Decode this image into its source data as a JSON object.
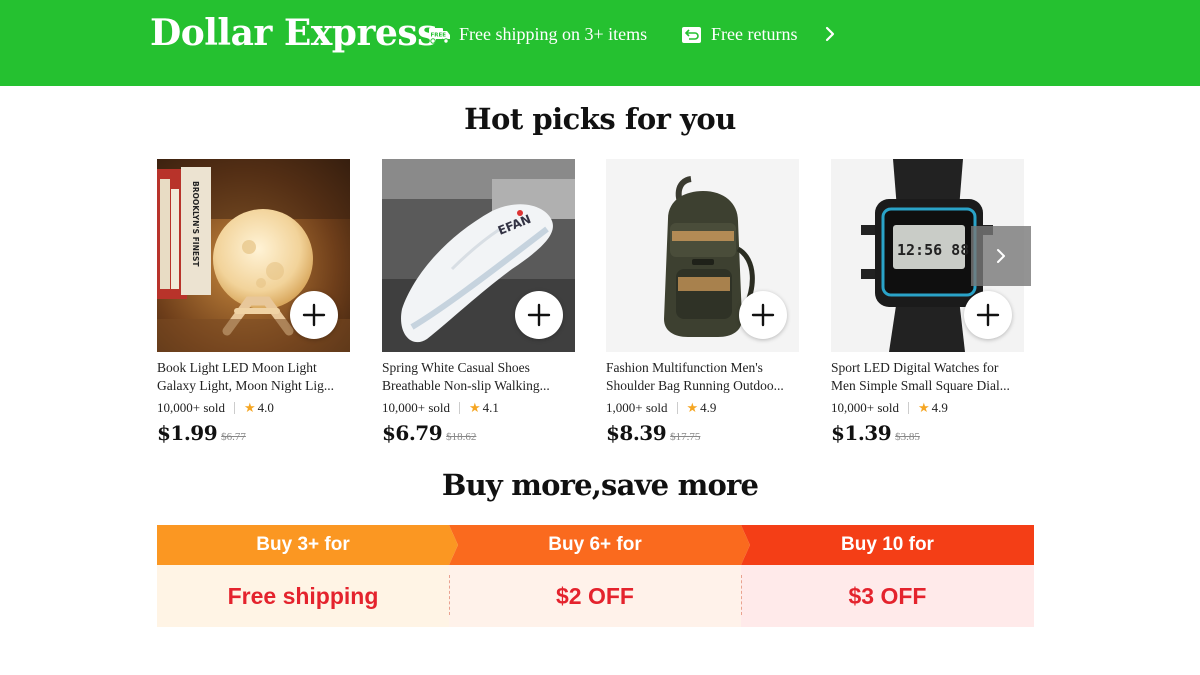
{
  "header": {
    "brand": "Dollar Express",
    "perks": [
      {
        "label": "Free shipping on 3+ items",
        "icon": "free-shipping-truck-icon"
      },
      {
        "label": "Free returns",
        "icon": "free-returns-icon"
      }
    ],
    "more_icon": "chevron-right-icon",
    "background_color": "#25c130"
  },
  "hot_picks": {
    "title": "Hot picks for you",
    "products": [
      {
        "title_line1": "Book Light LED Moon Light",
        "title_line2": "Galaxy Light, Moon Night Lig...",
        "sold": "10,000+ sold",
        "rating": "4.0",
        "price": "$1.99",
        "original_price": "$6.77"
      },
      {
        "title_line1": "Spring White Casual Shoes",
        "title_line2": "Breathable Non-slip Walking...",
        "sold": "10,000+ sold",
        "rating": "4.1",
        "price": "$6.79",
        "original_price": "$18.62"
      },
      {
        "title_line1": "Fashion Multifunction Men's",
        "title_line2": "Shoulder Bag Running Outdoo...",
        "sold": "1,000+ sold",
        "rating": "4.9",
        "price": "$8.39",
        "original_price": "$17.75"
      },
      {
        "title_line1": "Sport LED Digital Watches for",
        "title_line2": "Men Simple Small Square Dial...",
        "sold": "10,000+ sold",
        "rating": "4.9",
        "price": "$1.39",
        "original_price": "$3.85"
      }
    ],
    "image_texts": {
      "book_spine": "BROOKLYN'S FINEST",
      "shoe_brand": "EFAN",
      "watch_display": "12:56 88"
    },
    "star_color": "#f5a623"
  },
  "promo": {
    "title": "Buy more,save more",
    "tiers": [
      {
        "head": "Buy 3+ for",
        "benefit": "Free shipping",
        "head_color": "#fb9722",
        "body_color": "#fff4e5"
      },
      {
        "head": "Buy 6+ for",
        "benefit": "$2 OFF",
        "head_color": "#fa6a1e",
        "body_color": "#fff2ea"
      },
      {
        "head": "Buy 10 for",
        "benefit": "$3 OFF",
        "head_color": "#f43e16",
        "body_color": "#ffeaea"
      }
    ],
    "benefit_color": "#e4232d"
  }
}
